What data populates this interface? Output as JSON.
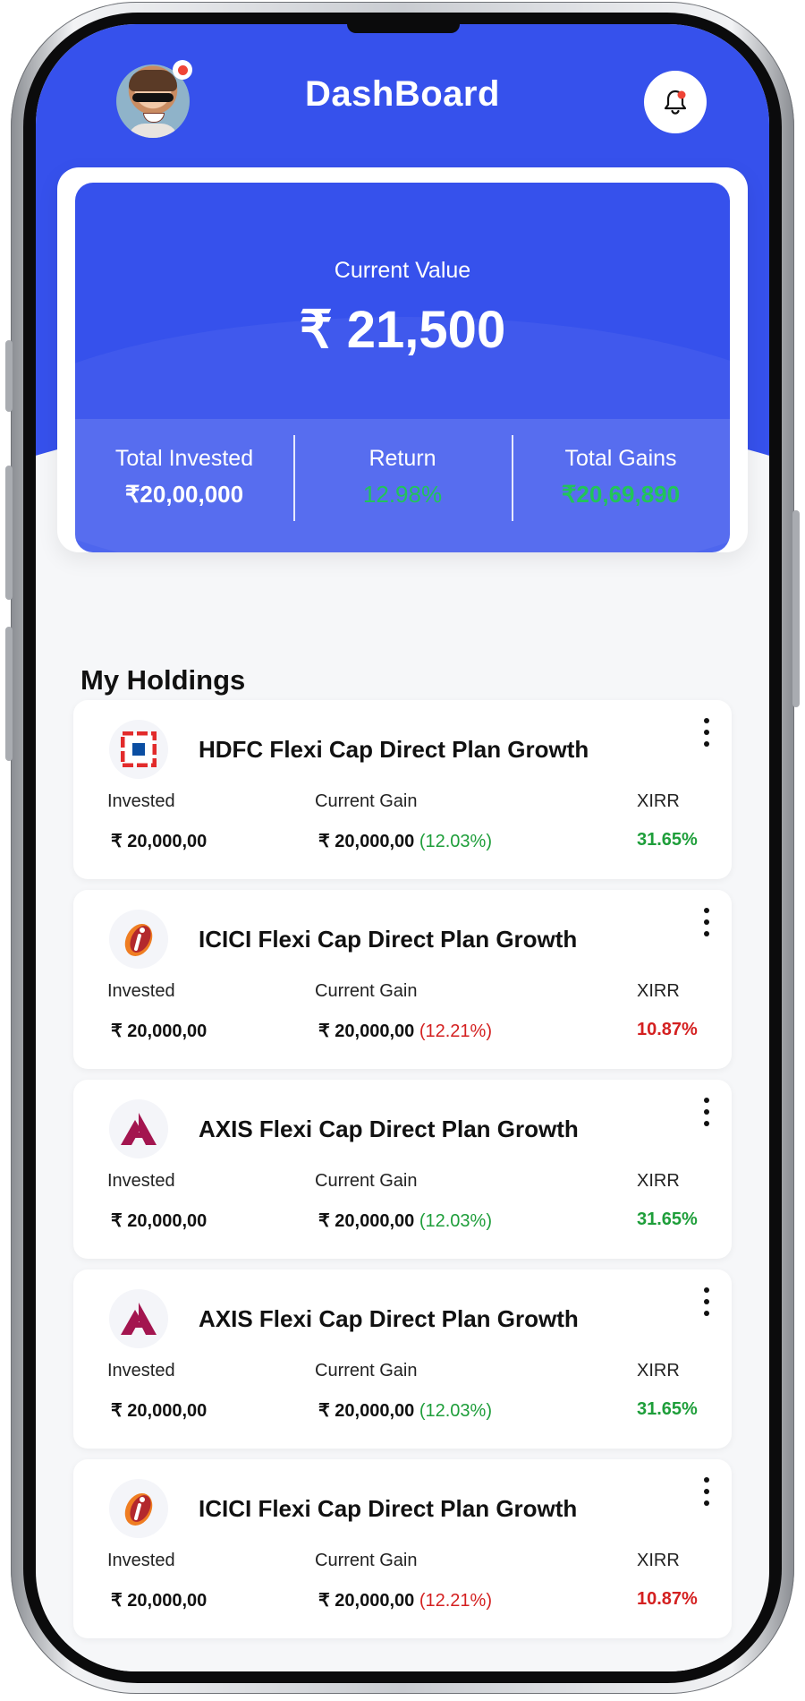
{
  "header": {
    "title": "DashBoard",
    "avatar_icon": "user-avatar",
    "notification_icon": "bell-icon"
  },
  "summary": {
    "current_value_label": "Current Value",
    "current_value": "₹ 21,500",
    "stats": [
      {
        "label": "Total Invested",
        "value": "₹20,00,000"
      },
      {
        "label": "Return",
        "value": "12.98%"
      },
      {
        "label": "Total Gains",
        "value": "₹20,69,890"
      }
    ]
  },
  "holdings_title": "My Holdings",
  "column_labels": {
    "invested": "Invested",
    "current_gain": "Current Gain",
    "xirr": "XIRR"
  },
  "holdings": [
    {
      "name": "HDFC Flexi Cap Direct Plan Growth",
      "logo": "hdfc-logo",
      "invested": "₹ 20,000,00",
      "current_gain": "₹ 20,000,00",
      "gain_pct": "(12.03%)",
      "xirr": "31.65%",
      "trend": "up"
    },
    {
      "name": "ICICI Flexi Cap Direct Plan Growth",
      "logo": "icici-logo",
      "invested": "₹ 20,000,00",
      "current_gain": "₹ 20,000,00",
      "gain_pct": "(12.21%)",
      "xirr": "10.87%",
      "trend": "down"
    },
    {
      "name": "AXIS Flexi Cap Direct Plan Growth",
      "logo": "axis-logo",
      "invested": "₹ 20,000,00",
      "current_gain": "₹ 20,000,00",
      "gain_pct": "(12.03%)",
      "xirr": "31.65%",
      "trend": "up"
    },
    {
      "name": "AXIS Flexi Cap Direct Plan Growth",
      "logo": "axis-logo",
      "invested": "₹ 20,000,00",
      "current_gain": "₹ 20,000,00",
      "gain_pct": "(12.03%)",
      "xirr": "31.65%",
      "trend": "up"
    },
    {
      "name": "ICICI Flexi Cap Direct Plan Growth",
      "logo": "icici-logo",
      "invested": "₹ 20,000,00",
      "current_gain": "₹ 20,000,00",
      "gain_pct": "(12.21%)",
      "xirr": "10.87%",
      "trend": "down"
    }
  ],
  "colors": {
    "primary": "#3651ec",
    "positive": "#1e9e3a",
    "negative": "#d42020",
    "highlight_green": "#21c45a"
  }
}
